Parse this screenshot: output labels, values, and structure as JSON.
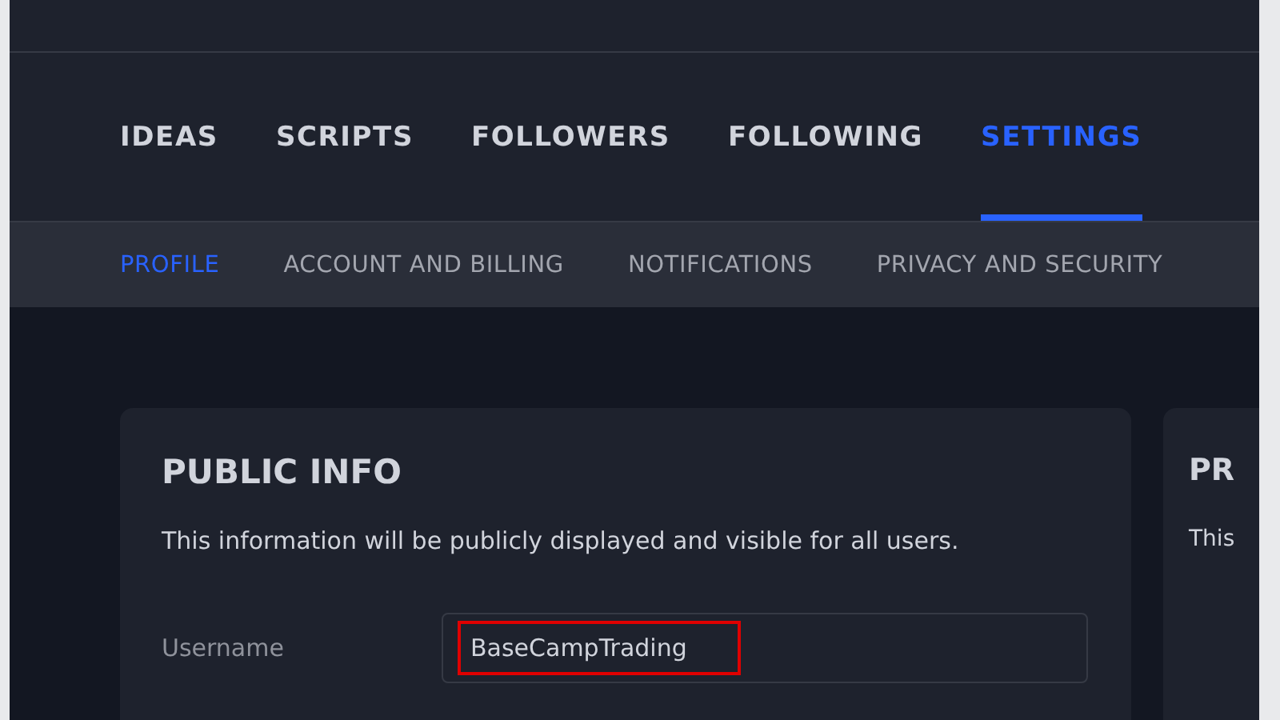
{
  "main_tabs": [
    {
      "label": "IDEAS",
      "selected": false
    },
    {
      "label": "SCRIPTS",
      "selected": false
    },
    {
      "label": "FOLLOWERS",
      "selected": false
    },
    {
      "label": "FOLLOWING",
      "selected": false
    },
    {
      "label": "SETTINGS",
      "selected": true
    }
  ],
  "sub_tabs": [
    {
      "label": "PROFILE",
      "selected": true
    },
    {
      "label": "ACCOUNT AND BILLING",
      "selected": false
    },
    {
      "label": "NOTIFICATIONS",
      "selected": false
    },
    {
      "label": "PRIVACY AND SECURITY",
      "selected": false
    }
  ],
  "public_info": {
    "title": "PUBLIC INFO",
    "description": "This information will be publicly displayed and visible for all users.",
    "fields": [
      {
        "label": "Username",
        "value": "BaseCampTrading",
        "highlighted": true
      }
    ]
  },
  "next_card": {
    "title": "PR",
    "description": "This"
  }
}
